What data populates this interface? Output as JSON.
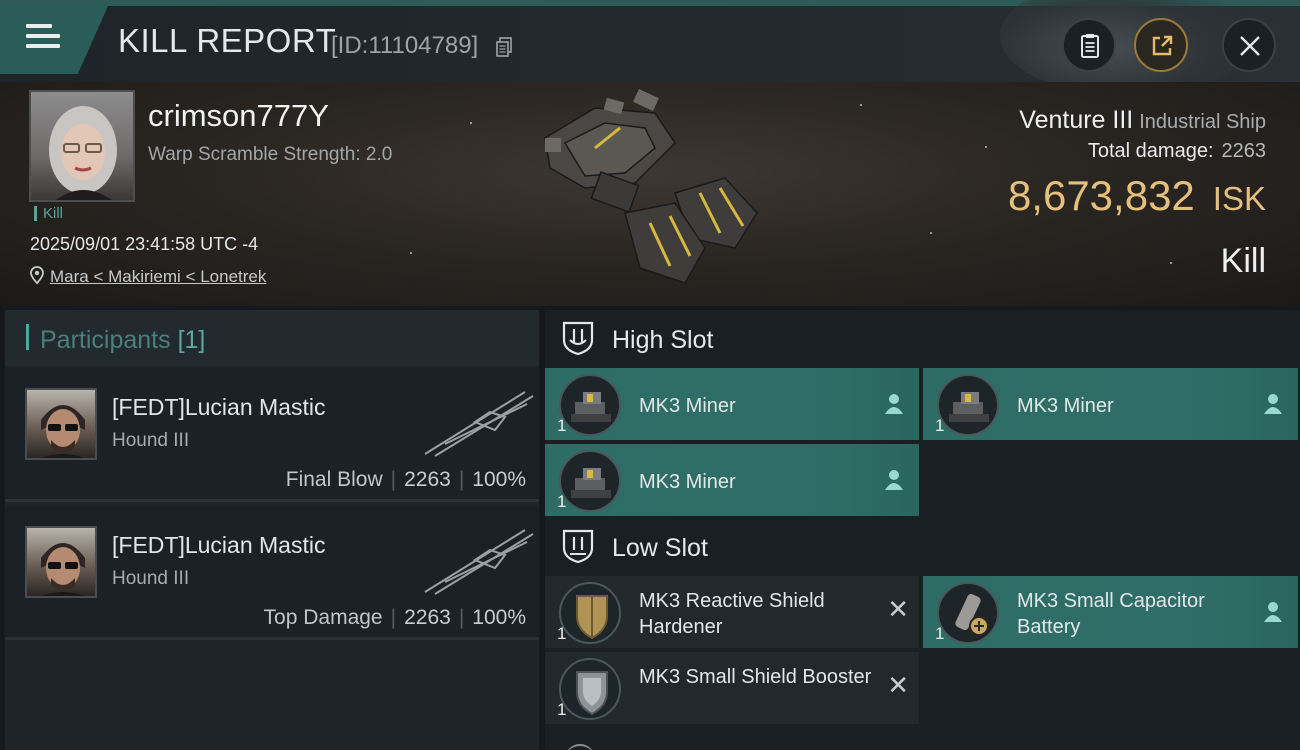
{
  "header": {
    "title": "KILL REPORT",
    "report_id": "[ID:11104789]",
    "icons": [
      "menu-icon",
      "copy-icon",
      "clipboard-icon",
      "share-icon",
      "close-icon"
    ]
  },
  "victim": {
    "name": "crimson777Y",
    "warp_scramble": "Warp Scramble Strength: 2.0",
    "result_tag": "Kill",
    "timestamp": "2025/09/01 23:41:58 UTC -4",
    "location": "Mara < Makiriemi < Lonetrek"
  },
  "ship": {
    "name": "Venture III",
    "class": "Industrial Ship",
    "total_damage_label": "Total damage:",
    "total_damage": "2263",
    "isk_value": "8,673,832",
    "isk_unit": "ISK",
    "outcome": "Kill"
  },
  "participants": {
    "title": "Participants",
    "count": "[1]",
    "items": [
      {
        "name": "[FEDT]Lucian Mastic",
        "ship": "Hound III",
        "role": "Final Blow",
        "damage": "2263",
        "percent": "100%"
      },
      {
        "name": "[FEDT]Lucian Mastic",
        "ship": "Hound III",
        "role": "Top Damage",
        "damage": "2263",
        "percent": "100%"
      }
    ]
  },
  "fitting": {
    "high_slot": {
      "label": "High Slot",
      "modules": [
        {
          "name": "MK3 Miner",
          "qty": "1"
        },
        {
          "name": "MK3 Miner",
          "qty": "1"
        },
        {
          "name": "MK3 Miner",
          "qty": "1"
        }
      ]
    },
    "low_slot": {
      "label": "Low Slot",
      "modules": [
        {
          "name": "MK3 Reactive Shield Hardener",
          "qty": "1"
        },
        {
          "name": "MK3 Small Capacitor Battery",
          "qty": "1"
        },
        {
          "name": "MK3 Small Shield Booster",
          "qty": "1"
        }
      ]
    }
  },
  "colors": {
    "accent_teal": "#2e6d66",
    "isk_gold": "#e6bf7a",
    "panel_dark": "#1c2125"
  }
}
